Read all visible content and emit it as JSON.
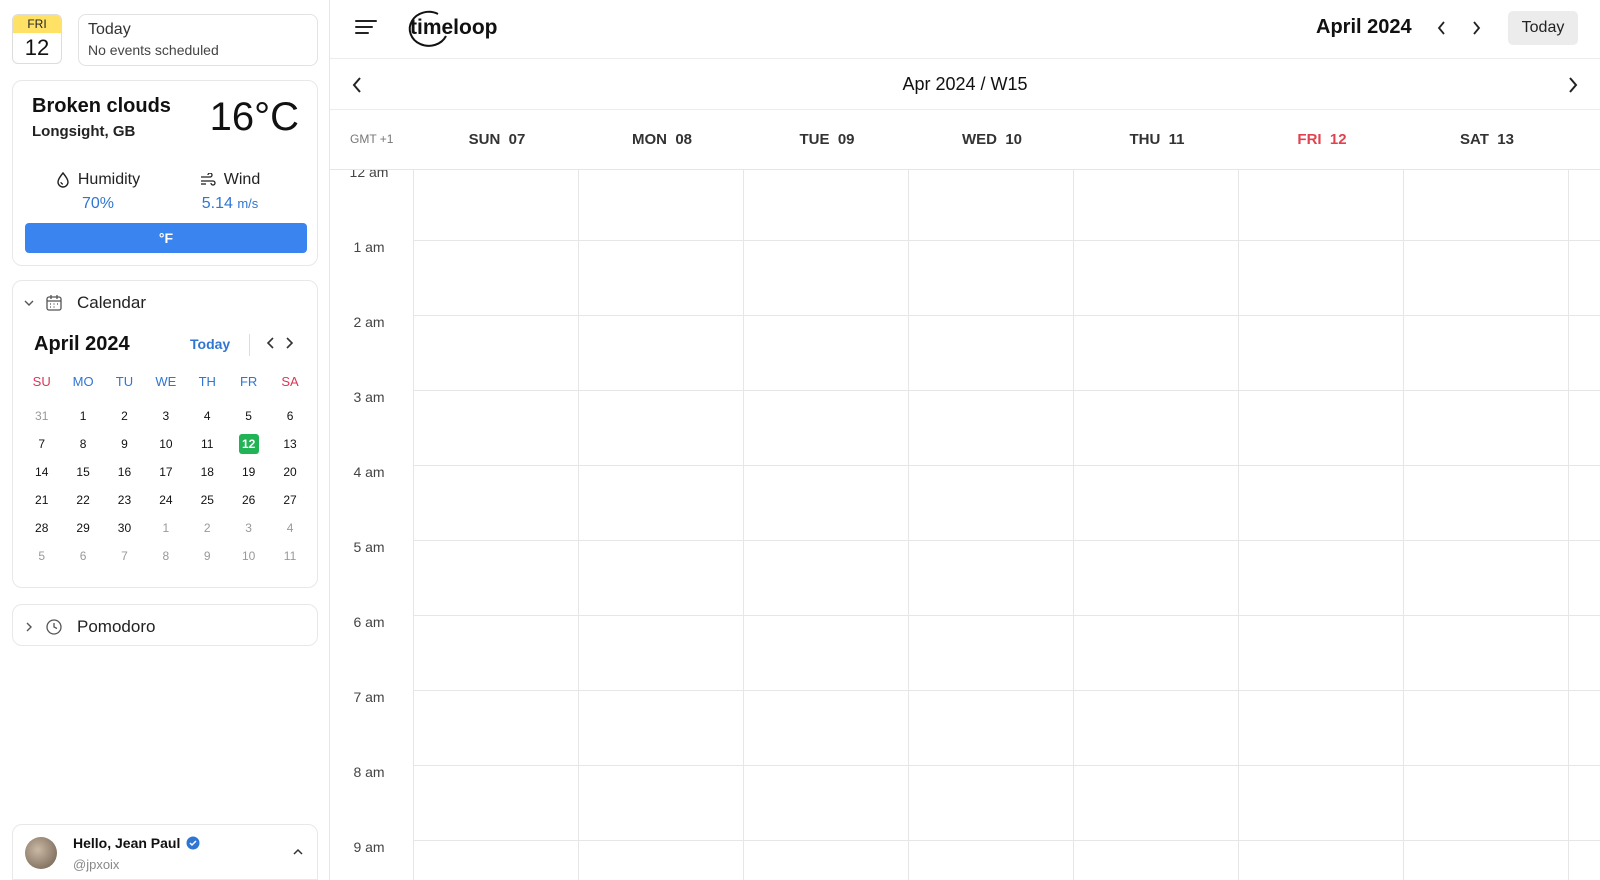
{
  "app": {
    "logo_text": "timeloop"
  },
  "sidebar": {
    "date_tile": {
      "weekday": "FRI",
      "day": "12"
    },
    "today_card": {
      "title": "Today",
      "subtitle": "No events scheduled"
    },
    "weather": {
      "condition": "Broken clouds",
      "location": "Longsight, GB",
      "temperature": "16°C",
      "humidity_label": "Humidity",
      "humidity_value": "70%",
      "wind_label": "Wind",
      "wind_value": "5.14",
      "wind_unit": "m/s",
      "unit_toggle": "°F"
    },
    "calendar": {
      "section_title": "Calendar",
      "month": "April 2024",
      "today_label": "Today",
      "weekdays": [
        "SU",
        "MO",
        "TU",
        "WE",
        "TH",
        "FR",
        "SA"
      ],
      "days": [
        [
          "31",
          "1",
          "2",
          "3",
          "4",
          "5",
          "6"
        ],
        [
          "7",
          "8",
          "9",
          "10",
          "11",
          "12",
          "13"
        ],
        [
          "14",
          "15",
          "16",
          "17",
          "18",
          "19",
          "20"
        ],
        [
          "21",
          "22",
          "23",
          "24",
          "25",
          "26",
          "27"
        ],
        [
          "28",
          "29",
          "30",
          "1",
          "2",
          "3",
          "4"
        ],
        [
          "5",
          "6",
          "7",
          "8",
          "9",
          "10",
          "11"
        ]
      ],
      "selected_day": "12"
    },
    "pomodoro": {
      "section_title": "Pomodoro"
    },
    "user": {
      "greeting": "Hello, Jean Paul",
      "handle": "@jpxoix"
    }
  },
  "topbar": {
    "month": "April 2024",
    "today_button": "Today"
  },
  "week_view": {
    "label": "Apr 2024 / W15",
    "timezone": "GMT +1",
    "days": [
      {
        "name": "SUN",
        "date": "07"
      },
      {
        "name": "MON",
        "date": "08"
      },
      {
        "name": "TUE",
        "date": "09"
      },
      {
        "name": "WED",
        "date": "10"
      },
      {
        "name": "THU",
        "date": "11"
      },
      {
        "name": "FRI",
        "date": "12"
      },
      {
        "name": "SAT",
        "date": "13"
      }
    ],
    "today_day": "FRI",
    "hours": [
      "12 am",
      "1 am",
      "2 am",
      "3 am",
      "4 am",
      "5 am",
      "6 am",
      "7 am",
      "8 am",
      "9 am"
    ]
  },
  "colors": {
    "accent": "#3a84ef",
    "link": "#2f76d2",
    "today_red": "#e2424e",
    "selected_green": "#21b356",
    "tile_yellow": "#ffe166"
  }
}
